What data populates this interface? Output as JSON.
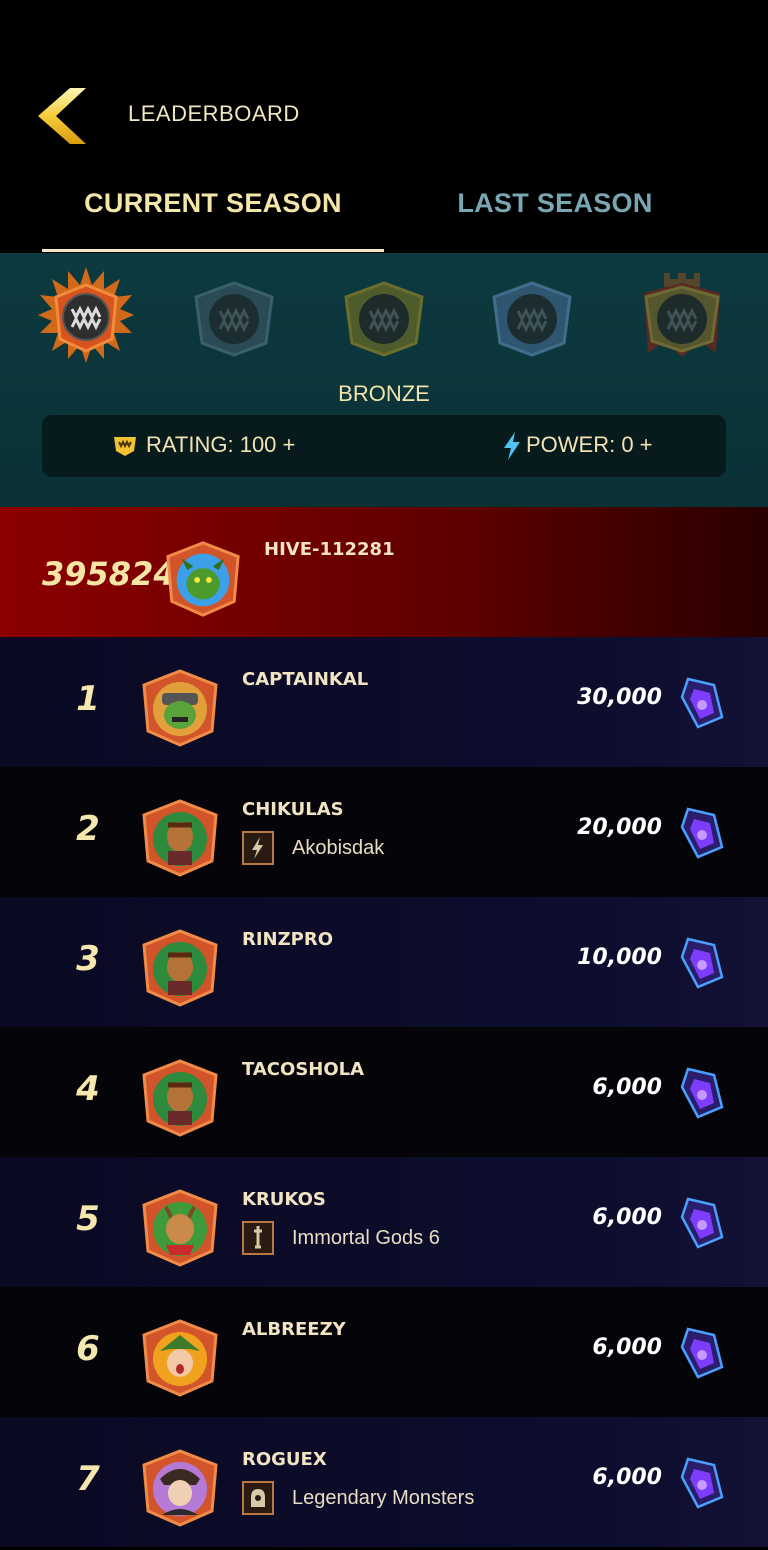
{
  "header": {
    "title": "LEADERBOARD",
    "back_icon": "back-chevron-icon"
  },
  "tabs": [
    {
      "label": "CURRENT SEASON",
      "active": true
    },
    {
      "label": "LAST SEASON",
      "active": false
    }
  ],
  "league": {
    "selected": "BRONZE",
    "rating_label": "RATING: 100 +",
    "power_label": "POWER: 0 +",
    "icons": [
      "bronze-league-icon",
      "silver-league-icon",
      "gold-league-icon",
      "diamond-league-icon",
      "champion-league-icon"
    ]
  },
  "player": {
    "rank": "395824",
    "name": "HIVE-112281"
  },
  "leaderboard": [
    {
      "rank": "1",
      "name": "CAPTAINKAL",
      "guild": "",
      "reward": "30,000"
    },
    {
      "rank": "2",
      "name": "CHIKULAS",
      "guild": "Akobisdak",
      "reward": "20,000"
    },
    {
      "rank": "3",
      "name": "RINZPRO",
      "guild": "",
      "reward": "10,000"
    },
    {
      "rank": "4",
      "name": "TACOSHOLA",
      "guild": "",
      "reward": "6,000"
    },
    {
      "rank": "5",
      "name": "KRUKOS",
      "guild": "Immortal Gods 6",
      "reward": "6,000"
    },
    {
      "rank": "6",
      "name": "ALBREEZY",
      "guild": "",
      "reward": "6,000"
    },
    {
      "rank": "7",
      "name": "ROGUEX",
      "guild": "Legendary Monsters",
      "reward": "6,000"
    }
  ],
  "colors": {
    "accent": "#f3e6a8",
    "inactive_tab": "#7aa6b3",
    "league_bg": "#0c3a3f",
    "player_row": "#8c0000"
  }
}
